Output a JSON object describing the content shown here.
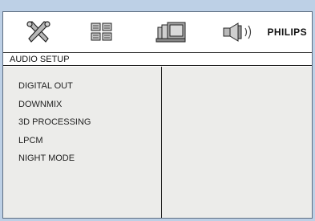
{
  "header": {
    "icons": [
      "tools-icon",
      "grid-icon",
      "display-icon",
      "speaker-icon"
    ],
    "brand": "PHILIPS"
  },
  "section": {
    "title": "AUDIO SETUP"
  },
  "menu": {
    "items": [
      {
        "label": "DIGITAL OUT"
      },
      {
        "label": "DOWNMIX"
      },
      {
        "label": "3D PROCESSING"
      },
      {
        "label": "LPCM"
      },
      {
        "label": "NIGHT MODE"
      }
    ]
  },
  "colors": {
    "frame_bg": "#bdd0e6",
    "panel_bg": "#ececea",
    "border": "#222222"
  }
}
